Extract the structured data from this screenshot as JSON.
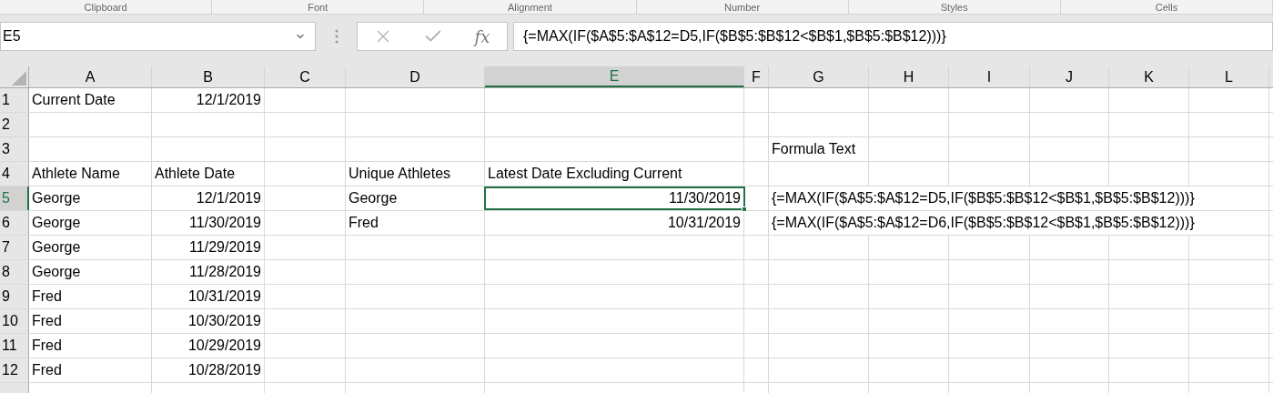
{
  "ribbon_groups": [
    "Clipboard",
    "Font",
    "Alignment",
    "Number",
    "Styles",
    "Cells"
  ],
  "formula_bar": {
    "name_box": "E5",
    "fx_label": "fx",
    "formula": "{=MAX(IF($A$5:$A$12=D5,IF($B$5:$B$12<$B$1,$B$5:$B$12)))}"
  },
  "columns": [
    {
      "label": "A",
      "selected": false
    },
    {
      "label": "B",
      "selected": false
    },
    {
      "label": "C",
      "selected": false
    },
    {
      "label": "D",
      "selected": false
    },
    {
      "label": "E",
      "selected": true
    },
    {
      "label": "F",
      "selected": false
    },
    {
      "label": "G",
      "selected": false
    },
    {
      "label": "H",
      "selected": false
    },
    {
      "label": "I",
      "selected": false
    },
    {
      "label": "J",
      "selected": false
    },
    {
      "label": "K",
      "selected": false
    },
    {
      "label": "L",
      "selected": false
    }
  ],
  "rows": [
    {
      "label": "1",
      "selected": false,
      "cells": [
        {
          "kind": "text",
          "text": "Current Date",
          "selected": false
        },
        {
          "kind": "number",
          "text": "12/1/2019",
          "selected": false
        },
        {
          "kind": "blank"
        },
        {
          "kind": "blank"
        },
        {
          "kind": "blank"
        },
        {
          "kind": "blank"
        },
        {
          "kind": "blank"
        },
        {
          "kind": "blank"
        },
        {
          "kind": "blank"
        },
        {
          "kind": "blank"
        },
        {
          "kind": "blank"
        },
        {
          "kind": "blank"
        }
      ]
    },
    {
      "label": "2",
      "selected": false,
      "cells": [
        {
          "kind": "blank"
        },
        {
          "kind": "blank"
        },
        {
          "kind": "blank"
        },
        {
          "kind": "blank"
        },
        {
          "kind": "blank"
        },
        {
          "kind": "blank"
        },
        {
          "kind": "blank"
        },
        {
          "kind": "blank"
        },
        {
          "kind": "blank"
        },
        {
          "kind": "blank"
        },
        {
          "kind": "blank"
        },
        {
          "kind": "blank"
        }
      ]
    },
    {
      "label": "3",
      "selected": false,
      "cells": [
        {
          "kind": "blank"
        },
        {
          "kind": "blank"
        },
        {
          "kind": "blank"
        },
        {
          "kind": "blank"
        },
        {
          "kind": "blank"
        },
        {
          "kind": "blank"
        },
        {
          "kind": "text",
          "text": "Formula Text",
          "selected": false
        },
        {
          "kind": "blank"
        },
        {
          "kind": "blank"
        },
        {
          "kind": "blank"
        },
        {
          "kind": "blank"
        },
        {
          "kind": "blank"
        }
      ]
    },
    {
      "label": "4",
      "selected": false,
      "cells": [
        {
          "kind": "text",
          "text": "Athlete Name",
          "selected": false
        },
        {
          "kind": "text",
          "text": "Athlete Date",
          "selected": false
        },
        {
          "kind": "blank"
        },
        {
          "kind": "text",
          "text": "Unique Athletes",
          "selected": false
        },
        {
          "kind": "text",
          "text": "Latest Date Excluding Current",
          "selected": false
        },
        {
          "kind": "blank"
        },
        {
          "kind": "blank"
        },
        {
          "kind": "blank"
        },
        {
          "kind": "blank"
        },
        {
          "kind": "blank"
        },
        {
          "kind": "blank"
        },
        {
          "kind": "blank"
        }
      ]
    },
    {
      "label": "5",
      "selected": true,
      "cells": [
        {
          "kind": "text",
          "text": "George",
          "selected": false
        },
        {
          "kind": "number",
          "text": "12/1/2019",
          "selected": false
        },
        {
          "kind": "blank"
        },
        {
          "kind": "text",
          "text": "George",
          "selected": false
        },
        {
          "kind": "number",
          "text": "11/30/2019",
          "selected": true
        },
        {
          "kind": "blank"
        },
        {
          "kind": "text",
          "text": "{=MAX(IF($A$5:$A$12=D5,IF($B$5:$B$12<$B$1,$B$5:$B$12)))}",
          "selected": false
        },
        {
          "kind": "blank"
        },
        {
          "kind": "blank"
        },
        {
          "kind": "blank"
        },
        {
          "kind": "blank"
        },
        {
          "kind": "blank"
        }
      ]
    },
    {
      "label": "6",
      "selected": false,
      "cells": [
        {
          "kind": "text",
          "text": "George",
          "selected": false
        },
        {
          "kind": "number",
          "text": "11/30/2019",
          "selected": false
        },
        {
          "kind": "blank"
        },
        {
          "kind": "text",
          "text": "Fred",
          "selected": false
        },
        {
          "kind": "number",
          "text": "10/31/2019",
          "selected": false
        },
        {
          "kind": "blank"
        },
        {
          "kind": "text",
          "text": "{=MAX(IF($A$5:$A$12=D6,IF($B$5:$B$12<$B$1,$B$5:$B$12)))}",
          "selected": false
        },
        {
          "kind": "blank"
        },
        {
          "kind": "blank"
        },
        {
          "kind": "blank"
        },
        {
          "kind": "blank"
        },
        {
          "kind": "blank"
        }
      ]
    },
    {
      "label": "7",
      "selected": false,
      "cells": [
        {
          "kind": "text",
          "text": "George",
          "selected": false
        },
        {
          "kind": "number",
          "text": "11/29/2019",
          "selected": false
        },
        {
          "kind": "blank"
        },
        {
          "kind": "blank"
        },
        {
          "kind": "blank"
        },
        {
          "kind": "blank"
        },
        {
          "kind": "blank"
        },
        {
          "kind": "blank"
        },
        {
          "kind": "blank"
        },
        {
          "kind": "blank"
        },
        {
          "kind": "blank"
        },
        {
          "kind": "blank"
        }
      ]
    },
    {
      "label": "8",
      "selected": false,
      "cells": [
        {
          "kind": "text",
          "text": "George",
          "selected": false
        },
        {
          "kind": "number",
          "text": "11/28/2019",
          "selected": false
        },
        {
          "kind": "blank"
        },
        {
          "kind": "blank"
        },
        {
          "kind": "blank"
        },
        {
          "kind": "blank"
        },
        {
          "kind": "blank"
        },
        {
          "kind": "blank"
        },
        {
          "kind": "blank"
        },
        {
          "kind": "blank"
        },
        {
          "kind": "blank"
        },
        {
          "kind": "blank"
        }
      ]
    },
    {
      "label": "9",
      "selected": false,
      "cells": [
        {
          "kind": "text",
          "text": "Fred",
          "selected": false
        },
        {
          "kind": "number",
          "text": "10/31/2019",
          "selected": false
        },
        {
          "kind": "blank"
        },
        {
          "kind": "blank"
        },
        {
          "kind": "blank"
        },
        {
          "kind": "blank"
        },
        {
          "kind": "blank"
        },
        {
          "kind": "blank"
        },
        {
          "kind": "blank"
        },
        {
          "kind": "blank"
        },
        {
          "kind": "blank"
        },
        {
          "kind": "blank"
        }
      ]
    },
    {
      "label": "10",
      "selected": false,
      "cells": [
        {
          "kind": "text",
          "text": "Fred",
          "selected": false
        },
        {
          "kind": "number",
          "text": "10/30/2019",
          "selected": false
        },
        {
          "kind": "blank"
        },
        {
          "kind": "blank"
        },
        {
          "kind": "blank"
        },
        {
          "kind": "blank"
        },
        {
          "kind": "blank"
        },
        {
          "kind": "blank"
        },
        {
          "kind": "blank"
        },
        {
          "kind": "blank"
        },
        {
          "kind": "blank"
        },
        {
          "kind": "blank"
        }
      ]
    },
    {
      "label": "11",
      "selected": false,
      "cells": [
        {
          "kind": "text",
          "text": "Fred",
          "selected": false
        },
        {
          "kind": "number",
          "text": "10/29/2019",
          "selected": false
        },
        {
          "kind": "blank"
        },
        {
          "kind": "blank"
        },
        {
          "kind": "blank"
        },
        {
          "kind": "blank"
        },
        {
          "kind": "blank"
        },
        {
          "kind": "blank"
        },
        {
          "kind": "blank"
        },
        {
          "kind": "blank"
        },
        {
          "kind": "blank"
        },
        {
          "kind": "blank"
        }
      ]
    },
    {
      "label": "12",
      "selected": false,
      "cells": [
        {
          "kind": "text",
          "text": "Fred",
          "selected": false
        },
        {
          "kind": "number",
          "text": "10/28/2019",
          "selected": false
        },
        {
          "kind": "blank"
        },
        {
          "kind": "blank"
        },
        {
          "kind": "blank"
        },
        {
          "kind": "blank"
        },
        {
          "kind": "blank"
        },
        {
          "kind": "blank"
        },
        {
          "kind": "blank"
        },
        {
          "kind": "blank"
        },
        {
          "kind": "blank"
        },
        {
          "kind": "blank"
        }
      ]
    }
  ]
}
